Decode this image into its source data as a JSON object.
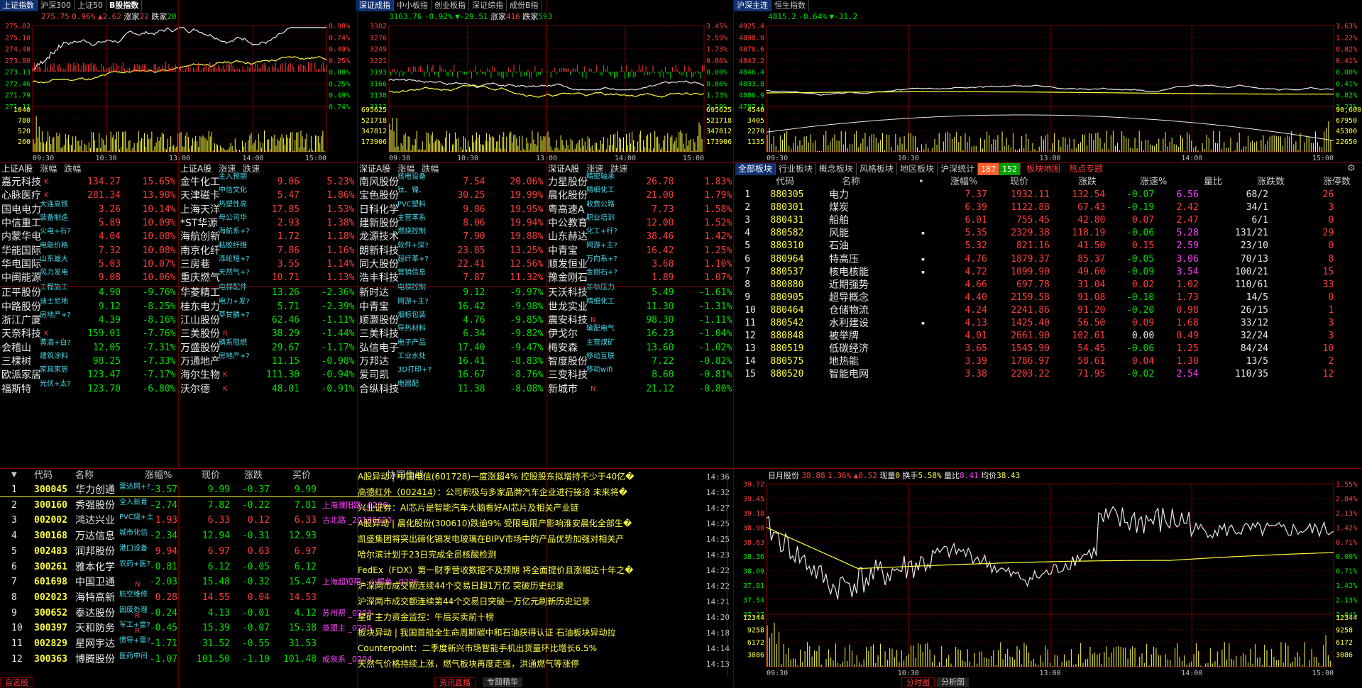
{
  "colors": {
    "up": "#ff3c3c",
    "down": "#00e000",
    "grid": "#800000",
    "bg": "#000000",
    "accent": "#ffff40"
  },
  "top_left": {
    "tabs": [
      "上证指数",
      "沪深300",
      "上证50",
      "B股指数"
    ],
    "info": {
      "price": "275.75",
      "pct": "0.96%",
      "chg": "▲2.62",
      "up_label": "涨家",
      "up": "22",
      "down_label": "跌家",
      "down": "20"
    },
    "y_left": [
      "275.82",
      "275.10",
      "274.48",
      "273.80",
      "273.13",
      "272.46",
      "271.79",
      "271.11",
      "1040",
      "780",
      "520",
      "260"
    ],
    "y_right": [
      "0.98%",
      "0.74%",
      "0.49%",
      "0.25%",
      "0.00%",
      "0.25%",
      "0.49%",
      "0.74%"
    ],
    "x": [
      "09:30",
      "10:30",
      "13:00",
      "14:00",
      "15:00"
    ]
  },
  "top_mid": {
    "tabs": [
      "深证成指",
      "中小板指",
      "创业板指",
      "深证综指",
      "成份B指"
    ],
    "info": {
      "price": "3163.76",
      "pct": "-0.92%",
      "chg": "▼-29.51",
      "up_label": "涨家",
      "up": "416",
      "down_label": "跌家",
      "down": "593"
    },
    "y_left": [
      "3302",
      "3276",
      "3249",
      "3221",
      "3193",
      "3166",
      "3138",
      "3111",
      "695625",
      "521718",
      "347812",
      "173906"
    ],
    "y_right": [
      "3.45%",
      "2.59%",
      "1.73%",
      "0.86%",
      "0.00%",
      "0.86%",
      "1.73%",
      "2.59%",
      "695625",
      "521718",
      "347812",
      "173906"
    ],
    "x": [
      "09:30",
      "10:30",
      "13:00",
      "14:00",
      "15:00"
    ]
  },
  "top_right": {
    "tabs": [
      "沪深主连",
      "恒生指数"
    ],
    "info": {
      "price": "4815.2",
      "pct": "-0.64%",
      "chg": "▼-31.2"
    },
    "y_left": [
      "4925.4",
      "4898.0",
      "4870.6",
      "4843.2",
      "4846.4",
      "4833.8",
      "4806.9",
      "4787.1",
      "4540",
      "3405",
      "2270",
      "1135"
    ],
    "y_right": [
      "1.63%",
      "1.22%",
      "0.82%",
      "0.41%",
      "0.00%",
      "0.41%",
      "0.82%",
      "1.22%",
      "90,600",
      "67950",
      "45300",
      "22650"
    ],
    "x": [
      "09:30",
      "10:30",
      "13:00",
      "14:00",
      "15:00"
    ]
  },
  "lists": [
    {
      "header": [
        "上证A股",
        "涨幅",
        "跌幅"
      ],
      "up": [
        [
          "嘉元科技",
          "134.27",
          "15.65%",
          "K",
          ""
        ],
        [
          "心脉医疗",
          "281.34",
          "13.90%",
          "K",
          ""
        ],
        [
          "国电电力",
          "3.26",
          "10.14%",
          "",
          "大连高铁"
        ],
        [
          "中信重工",
          "5.89",
          "10.09%",
          "",
          "装备制造"
        ],
        [
          "内蒙华电",
          "4.04",
          "10.08%",
          "",
          "火电+石?"
        ],
        [
          "华能国际",
          "7.32",
          "10.08%",
          "",
          "电能价格"
        ],
        [
          "华电国际",
          "5.03",
          "10.07%",
          "",
          "山东最大"
        ],
        [
          "中闽能源",
          "9.08",
          "10.06%",
          "",
          "风力发电"
        ]
      ],
      "down": [
        [
          "正平股份",
          "4.90",
          "-9.76%",
          "",
          "工程施工"
        ],
        [
          "中路股份",
          "9.12",
          "-8.25%",
          "",
          "迪士尼地"
        ],
        [
          "浙江广厦",
          "4.39",
          "-8.16%",
          "",
          "房地产+?"
        ],
        [
          "天奈科技",
          "159.01",
          "-7.76%",
          "K",
          ""
        ],
        [
          "会稽山",
          "12.05",
          "-7.31%",
          "",
          "黄酒+白?"
        ],
        [
          "三棵树",
          "98.25",
          "-7.33%",
          "",
          "建筑涂料"
        ],
        [
          "欧派家居",
          "123.47",
          "-7.17%",
          "",
          "家具家居"
        ],
        [
          "福斯特",
          "123.70",
          "-6.80%",
          "",
          "光伏+太?"
        ]
      ]
    },
    {
      "header": [
        "上证A股",
        "涨速",
        "跌速"
      ],
      "up": [
        [
          "金牛化工",
          "9.06",
          "5.23%",
          "",
          "主入预期"
        ],
        [
          "天津磁卡",
          "5.47",
          "1.86%",
          "",
          "中信文化"
        ],
        [
          "上海天洋",
          "17.85",
          "1.53%",
          "",
          "热塑性高"
        ],
        [
          "*ST华源",
          "2.93",
          "1.38%",
          "",
          "母公司华"
        ],
        [
          "海航创新",
          "1.72",
          "1.18%",
          "",
          "海航系+?"
        ],
        [
          "南京化纤",
          "7.86",
          "1.16%",
          "",
          "粘胶纤维"
        ],
        [
          "三房巷",
          "3.55",
          "1.14%",
          "",
          "涤纶短+?"
        ],
        [
          "重庆燃气",
          "10.71",
          "1.13%",
          "",
          "天然气+?"
        ]
      ],
      "down": [
        [
          "华菱精工",
          "13.26",
          "-2.36%",
          "",
          "电梯配件"
        ],
        [
          "桂东电力",
          "5.71",
          "-2.39%",
          "",
          "电力+发?"
        ],
        [
          "江山股份",
          "62.46",
          "-1.11%",
          "",
          "草甘膦+?"
        ],
        [
          "三美股份",
          "38.29",
          "-1.44%",
          "R",
          ""
        ],
        [
          "万盛股份",
          "29.67",
          "-1.17%",
          "",
          "磷系阻燃"
        ],
        [
          "万通地产",
          "11.15",
          "-0.98%",
          "",
          "房地产+?"
        ],
        [
          "海尔生物",
          "111.30",
          "-0.94%",
          "K",
          ""
        ],
        [
          "沃尔德",
          "48.01",
          "-0.91%",
          "K",
          ""
        ]
      ]
    },
    {
      "header": [
        "深证A股",
        "涨幅",
        "跌幅"
      ],
      "up": [
        [
          "南风股份",
          "7.54",
          "20.06%",
          "",
          "核电设备"
        ],
        [
          "宝色股份",
          "30.25",
          "19.99%",
          "",
          "钛、镍、"
        ],
        [
          "日科化学",
          "9.86",
          "19.95%",
          "",
          "PVC塑料"
        ],
        [
          "建新股份",
          "8.06",
          "19.94%",
          "",
          "主营苯系"
        ],
        [
          "龙源技术",
          "7.90",
          "19.88%",
          "",
          "燃烧控制"
        ],
        [
          "朗新科技",
          "23.85",
          "13.25%",
          "",
          "软件+深?"
        ],
        [
          "同大股份",
          "22.41",
          "12.56%",
          "",
          "超纤革+?"
        ],
        [
          "浩丰科技",
          "7.87",
          "11.32%",
          "",
          "营销信息"
        ]
      ],
      "down": [
        [
          "新时达",
          "9.12",
          "-9.97%",
          "",
          "电梯控制"
        ],
        [
          "中青宝",
          "16.42",
          "-9.98%",
          "",
          "网游+主?"
        ],
        [
          "顺灏股份",
          "4.76",
          "-9.85%",
          "",
          "烟标包装"
        ],
        [
          "三美科技",
          "6.34",
          "-9.82%",
          "",
          "导热材料"
        ],
        [
          "弘信电子",
          "17.40",
          "-9.47%",
          "",
          "电子产品"
        ],
        [
          "万邦达",
          "16.41",
          "-8.83%",
          "",
          "工业水处"
        ],
        [
          "爱司凯",
          "16.67",
          "-8.76%",
          "",
          "3D打印+?"
        ],
        [
          "合纵科技",
          "11.38",
          "-8.08%",
          "",
          "电器配"
        ]
      ]
    },
    {
      "header": [
        "深证A股",
        "涨速",
        "跌速"
      ],
      "up": [
        [
          "力星股份",
          "26.78",
          "1.83%",
          "",
          "精密轴承"
        ],
        [
          "晨化股份",
          "21.00",
          "1.79%",
          "",
          "精细化工"
        ],
        [
          "粤高速A",
          "7.73",
          "1.58%",
          "",
          "收费公路"
        ],
        [
          "中公教育",
          "12.00",
          "1.52%",
          "",
          "职业培训"
        ],
        [
          "山东赫达",
          "38.46",
          "1.42%",
          "",
          "化工+纤?"
        ],
        [
          "中青宝",
          "16.42",
          "1.25%",
          "",
          "网游+主?"
        ],
        [
          "顺发恒业",
          "3.68",
          "1.10%",
          "",
          "万向系+?"
        ],
        [
          "豫金刚石",
          "1.89",
          "1.07%",
          "",
          "金刚石+?"
        ]
      ],
      "down": [
        [
          "天沃科技",
          "5.49",
          "-1.61%",
          "",
          "非标压力"
        ],
        [
          "世龙实业",
          "11.30",
          "-1.31%",
          "",
          "精细化工"
        ],
        [
          "震安科技",
          "98.30",
          "-1.11%",
          "N",
          ""
        ],
        [
          "伊戈尔",
          "16.23",
          "-1.04%",
          "",
          "输配电气"
        ],
        [
          "梅安森",
          "13.60",
          "-1.02%",
          "",
          "主营煤矿"
        ],
        [
          "智度股份",
          "7.22",
          "-0.82%",
          "",
          "移动互联"
        ],
        [
          "三变科技",
          "8.60",
          "-0.81%",
          "",
          "移动wifi"
        ],
        [
          "新城市",
          "21.12",
          "-0.80%",
          "N",
          ""
        ]
      ]
    }
  ],
  "sectors": {
    "tabs": [
      "全部板块",
      "行业板块",
      "概念板块",
      "风格板块",
      "地区板块",
      "沪深统计"
    ],
    "counter_up": "187",
    "counter_down": "152",
    "extra_tabs": [
      "板块地图",
      "热点专题"
    ],
    "columns": [
      "代码",
      "名称",
      "•",
      "涨幅%",
      "现价",
      "涨跌",
      "涨速%",
      "量比",
      "涨跌数",
      "涨停数"
    ],
    "rows": [
      [
        "1",
        "880305",
        "电力",
        "",
        "7.37",
        "1932.11",
        "132.54",
        "-0.07",
        "6.56",
        "68/2",
        "26"
      ],
      [
        "2",
        "880301",
        "煤炭",
        "",
        "6.39",
        "1122.88",
        "67.43",
        "-0.19",
        "2.42",
        "34/1",
        "3"
      ],
      [
        "3",
        "880431",
        "船舶",
        "",
        "6.01",
        "755.45",
        "42.80",
        "0.07",
        "2.47",
        "6/1",
        "0"
      ],
      [
        "4",
        "880582",
        "风能",
        "▪",
        "5.35",
        "2329.38",
        "118.19",
        "-0.06",
        "5.28",
        "131/21",
        "29"
      ],
      [
        "5",
        "880310",
        "石油",
        "",
        "5.32",
        "821.16",
        "41.50",
        "0.15",
        "2.59",
        "23/10",
        "0"
      ],
      [
        "6",
        "880964",
        "特高压",
        "▪",
        "4.76",
        "1879.37",
        "85.37",
        "-0.05",
        "3.06",
        "70/13",
        "8"
      ],
      [
        "7",
        "880537",
        "核电核能",
        "▪",
        "4.72",
        "1099.90",
        "49.60",
        "-0.09",
        "3.54",
        "100/21",
        "15"
      ],
      [
        "8",
        "880880",
        "近期强势",
        "",
        "4.66",
        "697.78",
        "31.04",
        "0.02",
        "1.02",
        "110/61",
        "33"
      ],
      [
        "9",
        "880905",
        "超导概念",
        "",
        "4.40",
        "2159.58",
        "91.08",
        "-0.10",
        "1.73",
        "14/5",
        "0"
      ],
      [
        "10",
        "880464",
        "仓储物流",
        "",
        "4.24",
        "2241.86",
        "91.20",
        "-0.20",
        "0.98",
        "26/15",
        "1"
      ],
      [
        "11",
        "880542",
        "水利建设",
        "▪",
        "4.13",
        "1425.40",
        "56.50",
        "0.09",
        "1.68",
        "33/12",
        "3"
      ],
      [
        "12",
        "880848",
        "被举牌",
        "",
        "4.01",
        "2661.90",
        "102.61",
        "0.00",
        "0.49",
        "32/24",
        "3"
      ],
      [
        "13",
        "880519",
        "低碳经济",
        "",
        "3.65",
        "1545.90",
        "54.45",
        "-0.06",
        "1.25",
        "84/24",
        "10"
      ],
      [
        "14",
        "880575",
        "地热能",
        "",
        "3.39",
        "1786.97",
        "58.61",
        "0.04",
        "1.30",
        "13/5",
        "2"
      ],
      [
        "15",
        "880520",
        "智能电网",
        "",
        "3.38",
        "2203.22",
        "71.95",
        "-0.02",
        "2.54",
        "110/35",
        "12"
      ]
    ]
  },
  "watch": {
    "columns": [
      "代码",
      "名称",
      "涨幅%",
      "现价",
      "涨跌",
      "买价",
      "协同作战"
    ],
    "rows": [
      [
        "1",
        "300045",
        "华力创通",
        "",
        "雷达网+?",
        "-3.57",
        "9.99",
        "-0.37",
        "9.99",
        ""
      ],
      [
        "2",
        "300160",
        "秀强股份",
        "",
        "全入新育",
        "-2.74",
        "7.82",
        "-0.22",
        "7.81",
        "上海濮阳路 _0206"
      ],
      [
        "3",
        "002002",
        "鸿达兴业",
        "",
        "PVC烧+土",
        "1.93",
        "6.33",
        "0.12",
        "6.33",
        "古北路 _20190620"
      ],
      [
        "4",
        "300168",
        "万达信息",
        "",
        "城市化信",
        "-2.34",
        "12.94",
        "-0.31",
        "12.93",
        ""
      ],
      [
        "5",
        "002483",
        "润邦股份",
        "",
        "港口设备",
        "9.94",
        "6.97",
        "0.63",
        "6.97",
        ""
      ],
      [
        "6",
        "300261",
        "雅本化学",
        "",
        "农药+医?",
        "-0.81",
        "6.12",
        "-0.05",
        "6.12",
        ""
      ],
      [
        "7",
        "601698",
        "中国卫通",
        "N",
        "",
        "-2.03",
        "15.48",
        "-0.32",
        "15.47",
        "上海超短帮，小鳄鱼 _0206"
      ],
      [
        "8",
        "002023",
        "海特高新",
        "",
        "航空维修",
        "0.28",
        "14.55",
        "0.04",
        "14.53",
        ""
      ],
      [
        "9",
        "300652",
        "泰达股份",
        "R",
        "固废处理",
        "-0.24",
        "4.13",
        "-0.01",
        "4.12",
        "苏州帮 _0203"
      ],
      [
        "10",
        "300397",
        "天和防务",
        "R",
        "军工+雷?",
        "-0.45",
        "15.39",
        "-0.07",
        "15.38",
        "章盟主 _0205"
      ],
      [
        "11",
        "002829",
        "星网宇达",
        "",
        "惯导+雷?",
        "-1.71",
        "31.52",
        "-0.55",
        "31.53",
        ""
      ],
      [
        "12",
        "300363",
        "博腾股份",
        "",
        "医药中间",
        "-1.07",
        "101.50",
        "-1.10",
        "101.48",
        "成泉系 _0204"
      ]
    ]
  },
  "news": [
    [
      "A股异动 | 中国电信(601728)一度涨超4% 控股股东拟增持不少于40亿�",
      "14:36"
    ],
    [
      "高德红外（002414）：公司积极与多家品牌汽车企业进行接洽 未来将�",
      "14:32"
    ],
    [
      "兴业证券：AI芯片是智能汽车大脑看好AI芯片及相关产业链",
      "14:27"
    ],
    [
      "A股异动 | 晨化股份(300610)跌逾9% 受限电限产影响淮安晨化全部生�",
      "14:25"
    ],
    [
      "凯盛集团将突出碲化镉发电玻璃在BIPV市场中的产品优势加强对相关产",
      "14:25"
    ],
    [
      "哈尔滨计划于23日完成全员核酸检测",
      "14:23"
    ],
    [
      "FedEx（FDX）第一财季营收数据不及预期 将全面提价且涨幅达十年之�",
      "14:22"
    ],
    [
      "沪深两市成交额连续44个交易日超1万亿 突破历史纪录",
      "14:22"
    ],
    [
      "沪深两市成交额连续第44个交易日突破一万亿元刷新历史记录",
      "14:21"
    ],
    [
      "星矿主力资金监控：午后买卖前十榜",
      "14:20"
    ],
    [
      "板块异动 | 我国首船全生命周期碳中和石油获得认证 石油板块异动拉",
      "14:18"
    ],
    [
      "Counterpoint：二季度新兴市场智能手机出货量环比增长6.5%",
      "14:14"
    ],
    [
      "天然气价格持续上涨，燃气板块再度走强，洪通燃气等涨停",
      "14:13"
    ]
  ],
  "stock_chart": {
    "title": "日月股份",
    "price": "38.88",
    "pct": "1.36%",
    "chg": "▲0.52",
    "vol_label": "现量",
    "vol": "0",
    "turn_label": "换手",
    "turn": "5.58%",
    "lb_label": "量比",
    "lb": "8.41",
    "avg_label": "均价",
    "avg": "38.43",
    "y_left": [
      "39.72",
      "39.45",
      "39.18",
      "38.90",
      "38.63",
      "38.36",
      "38.09",
      "37.81",
      "37.54",
      "37.27",
      "12344",
      "9258",
      "6172",
      "3086"
    ],
    "y_right": [
      "3.55%",
      "2.84%",
      "2.13%",
      "1.42%",
      "0.71%",
      "0.00%",
      "0.71%",
      "1.42%",
      "2.13%",
      "2.84%",
      "12344",
      "9258",
      "6172",
      "3086"
    ],
    "x": [
      "09:30",
      "10:30",
      "13:00",
      "14:00",
      "15:00"
    ]
  },
  "bottom_tabs": {
    "left": [
      "自选股"
    ],
    "mid": [
      "资讯直播",
      "专题精华"
    ],
    "right": [
      "分时图",
      "分析图"
    ]
  }
}
